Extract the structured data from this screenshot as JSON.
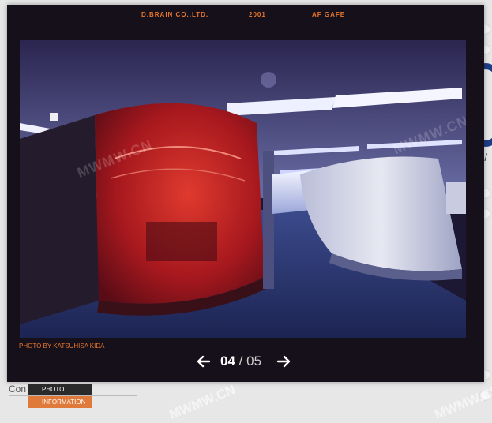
{
  "project": {
    "company": "D.BRAIN CO.,LTD.",
    "year": "2001",
    "title": "AF GAFE"
  },
  "photo": {
    "alt": "",
    "credit": "PHOTO BY KATSUHISA KIDA",
    "watermark": "MWMW.CN"
  },
  "pager": {
    "current": "04",
    "separator": "/",
    "total": "05",
    "prev_icon": "arrow-left-icon",
    "next_icon": "arrow-right-icon"
  },
  "menu": {
    "items": [
      {
        "label": "PHOTO"
      },
      {
        "label": "INFORMATION"
      }
    ]
  },
  "background": {
    "partial_text": "Con",
    "right_fragment": "; /"
  },
  "colors": {
    "frame": "#151019",
    "accent": "#e8762c",
    "menu_dark": "#2a2a2a",
    "menu_active": "#e07a3a"
  }
}
